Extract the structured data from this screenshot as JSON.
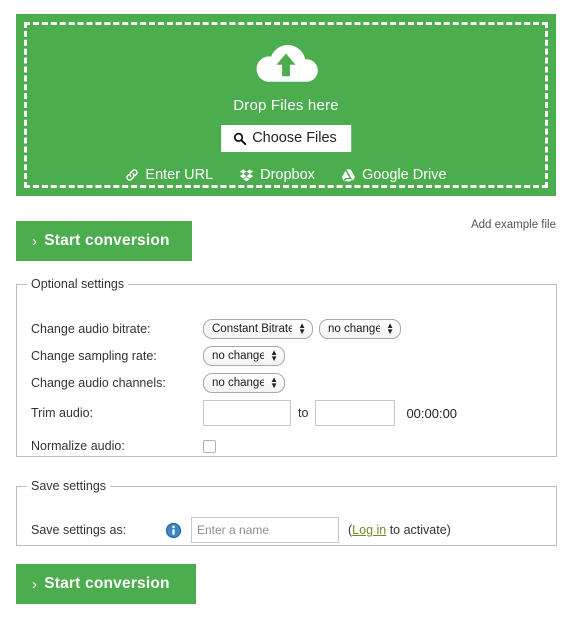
{
  "dropzone": {
    "icon": "cloud-upload-icon",
    "drop_text": "Drop Files here",
    "choose_files_label": "Choose Files",
    "choose_files_icon": "search-icon",
    "sources": [
      {
        "label": "Enter URL",
        "icon": "link-icon"
      },
      {
        "label": "Dropbox",
        "icon": "dropbox-icon"
      },
      {
        "label": "Google Drive",
        "icon": "google-drive-icon"
      }
    ],
    "background_color": "#4cad4e"
  },
  "actions": {
    "start_conversion_top": "Start conversion",
    "start_conversion_bottom": "Start conversion",
    "chevron": "›",
    "add_example_file": "Add example file"
  },
  "optional_settings": {
    "legend": "Optional settings",
    "rows": [
      {
        "label": "Change audio bitrate:",
        "controls": [
          {
            "type": "select",
            "value": "Constant Bitrate"
          },
          {
            "type": "select",
            "value": "no change"
          }
        ]
      },
      {
        "label": "Change sampling rate:",
        "controls": [
          {
            "type": "select",
            "value": "no change"
          }
        ]
      },
      {
        "label": "Change audio channels:",
        "controls": [
          {
            "type": "select",
            "value": "no change"
          }
        ]
      },
      {
        "label": "Trim audio:",
        "from_value": "",
        "to_word": "to",
        "to_value": "",
        "duration": "00:00:00"
      },
      {
        "label": "Normalize audio:",
        "checked": false
      }
    ]
  },
  "save_settings": {
    "legend": "Save settings",
    "label": "Save settings as:",
    "info_icon": "info-icon",
    "name_placeholder": "Enter a name",
    "name_value": "",
    "note_open": "(",
    "note_link": "Log in",
    "note_rest": " to activate)",
    "link_color": "#6e8c2a"
  }
}
